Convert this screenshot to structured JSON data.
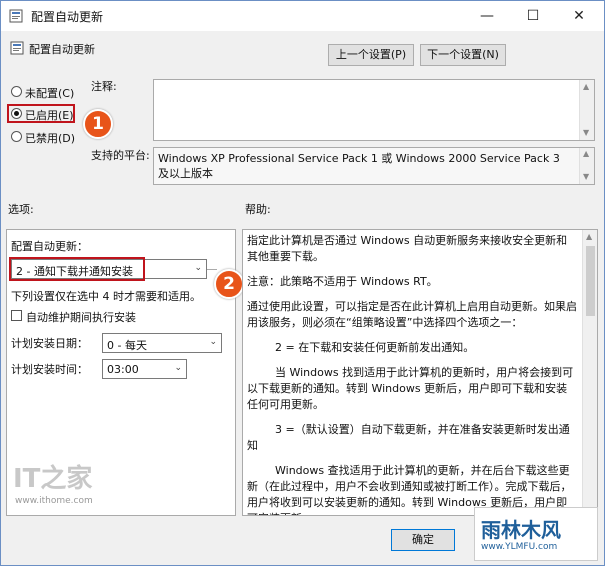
{
  "window": {
    "title": "配置自动更新",
    "controls": {
      "minimize": "—",
      "maximize": "☐",
      "close": "✕"
    }
  },
  "header": {
    "policy_name": "配置自动更新",
    "prev_button": "上一个设置(P)",
    "next_button": "下一个设置(N)"
  },
  "state": {
    "options": [
      {
        "label": "未配置(C)",
        "selected": false
      },
      {
        "label": "已启用(E)",
        "selected": true
      },
      {
        "label": "已禁用(D)",
        "selected": false
      }
    ]
  },
  "comment": {
    "label": "注释:",
    "value": ""
  },
  "platform": {
    "label": "支持的平台:",
    "value": "Windows XP Professional Service Pack 1 或 Windows 2000 Service Pack 3 及以上版本"
  },
  "options_panel": {
    "heading": "选项:",
    "configure_label": "配置自动更新：",
    "configure_value": "2 - 通知下载并通知安装",
    "note": "下列设置仅在选中 4 时才需要和适用。",
    "maintenance_checkbox": "自动维护期间执行安装",
    "install_day_label": "计划安装日期：",
    "install_day_value": "0 - 每天",
    "install_time_label": "计划安装时间：",
    "install_time_value": "03:00"
  },
  "help_panel": {
    "heading": "帮助:",
    "paragraphs": [
      "指定此计算机是否通过 Windows 自动更新服务来接收安全更新和其他重要下载。",
      "注意：此策略不适用于 Windows RT。",
      "通过使用此设置，可以指定是否在此计算机上启用自动更新。如果启用该服务，则必须在“组策略设置”中选择四个选项之一：",
      "2 = 在下载和安装任何更新前发出通知。",
      "当 Windows 找到适用于此计算机的更新时，用户将会接到可以下载更新的通知。转到 Windows 更新后，用户即可下载和安装任何可用更新。",
      "3 =（默认设置）自动下载更新，并在准备安装更新时发出通知",
      "Windows 查找适用于此计算机的更新，并在后台下载这些更新（在此过程中，用户不会收到通知或被打断工作）。完成下载后，用户将收到可以安装更新的通知。转到 Windows 更新后，用户即可安装更新。"
    ]
  },
  "footer": {
    "ok_button": "确定"
  },
  "annotations": {
    "badge1": "1",
    "badge2": "2"
  },
  "watermarks": {
    "ithome_logo": "IT之家",
    "ithome_url": "www.ithome.com",
    "ylmf_logo": "雨林木风",
    "ylmf_url": "www.YLMFU.com"
  },
  "colors": {
    "accent_red": "#c0141c",
    "badge_orange": "#e8541a"
  }
}
